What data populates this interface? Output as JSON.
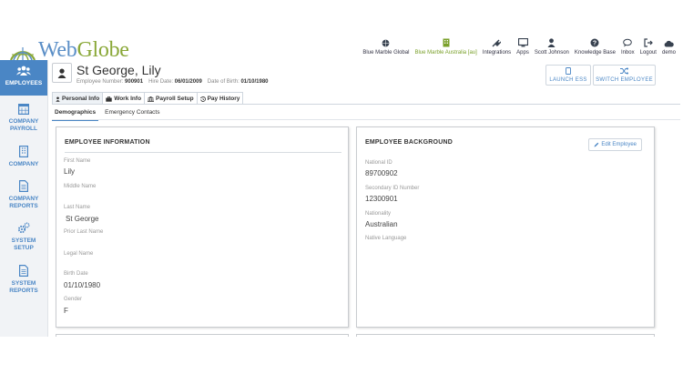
{
  "brand": {
    "name_part1": "Web",
    "name_part2": "Globe"
  },
  "topnav": [
    {
      "label": "Blue Marble Global",
      "icon": "globe-icon",
      "active": false
    },
    {
      "label": "Blue Marble Australia [au]",
      "icon": "building-icon",
      "active": true
    },
    {
      "label": "Integrations",
      "icon": "plug-icon",
      "active": false
    },
    {
      "label": "Apps",
      "icon": "monitor-icon",
      "active": false
    },
    {
      "label": "Scott Johnson",
      "icon": "user-icon",
      "active": false
    },
    {
      "label": "Knowledge Base",
      "icon": "question-icon",
      "active": false
    },
    {
      "label": "Inbox",
      "icon": "chat-icon",
      "active": false
    },
    {
      "label": "Logout",
      "icon": "logout-icon",
      "active": false
    },
    {
      "label": "demo",
      "icon": "cloud-icon",
      "active": false
    }
  ],
  "sidebar": [
    {
      "label": "EMPLOYEES",
      "icon": "users-icon"
    },
    {
      "label": "COMPANY PAYROLL",
      "icon": "calendar-icon"
    },
    {
      "label": "COMPANY",
      "icon": "building-icon"
    },
    {
      "label": "COMPANY REPORTS",
      "icon": "document-icon"
    },
    {
      "label": "SYSTEM SETUP",
      "icon": "gears-icon"
    },
    {
      "label": "SYSTEM REPORTS",
      "icon": "document-icon"
    }
  ],
  "employee": {
    "name": "St George, Lily",
    "number_label": "Employee Number:",
    "number": "900901",
    "hire_label": "Hire Date:",
    "hire_date": "06/01/2009",
    "dob_label": "Date of Birth:",
    "dob": "01/10/1980"
  },
  "actions": {
    "launch_ess": "LAUNCH ESS",
    "switch_employee": "SWITCH EMPLOYEE"
  },
  "tabs": [
    {
      "label": "Personal Info",
      "icon": "user-icon"
    },
    {
      "label": "Work Info",
      "icon": "briefcase-icon"
    },
    {
      "label": "Payroll Setup",
      "icon": "bank-icon"
    },
    {
      "label": "Pay History",
      "icon": "history-icon"
    }
  ],
  "subtabs": [
    "Demographics",
    "Emergency Contacts"
  ],
  "employee_info": {
    "title": "EMPLOYEE INFORMATION",
    "first_name_label": "First Name",
    "first_name": "Lily",
    "middle_name_label": "Middle Name",
    "middle_name": "",
    "last_name_label": "Last Name",
    "last_name": "St George",
    "prior_last_name_label": "Prior Last Name",
    "prior_last_name": "",
    "legal_name_label": "Legal Name",
    "legal_name": "",
    "birth_date_label": "Birth Date",
    "birth_date": "01/10/1980",
    "gender_label": "Gender",
    "gender": "F"
  },
  "employee_background": {
    "title": "EMPLOYEE BACKGROUND",
    "edit_label": "Edit Employee",
    "national_id_label": "National ID",
    "national_id": "89700902",
    "secondary_id_label": "Secondary ID Number",
    "secondary_id": "12300901",
    "nationality_label": "Nationality",
    "nationality": "Australian",
    "native_language_label": "Native Language",
    "native_language": ""
  },
  "colors": {
    "accent": "#4a86c5",
    "brand_green": "#7aa02a",
    "sidebar_bg": "#f1f3f6"
  }
}
